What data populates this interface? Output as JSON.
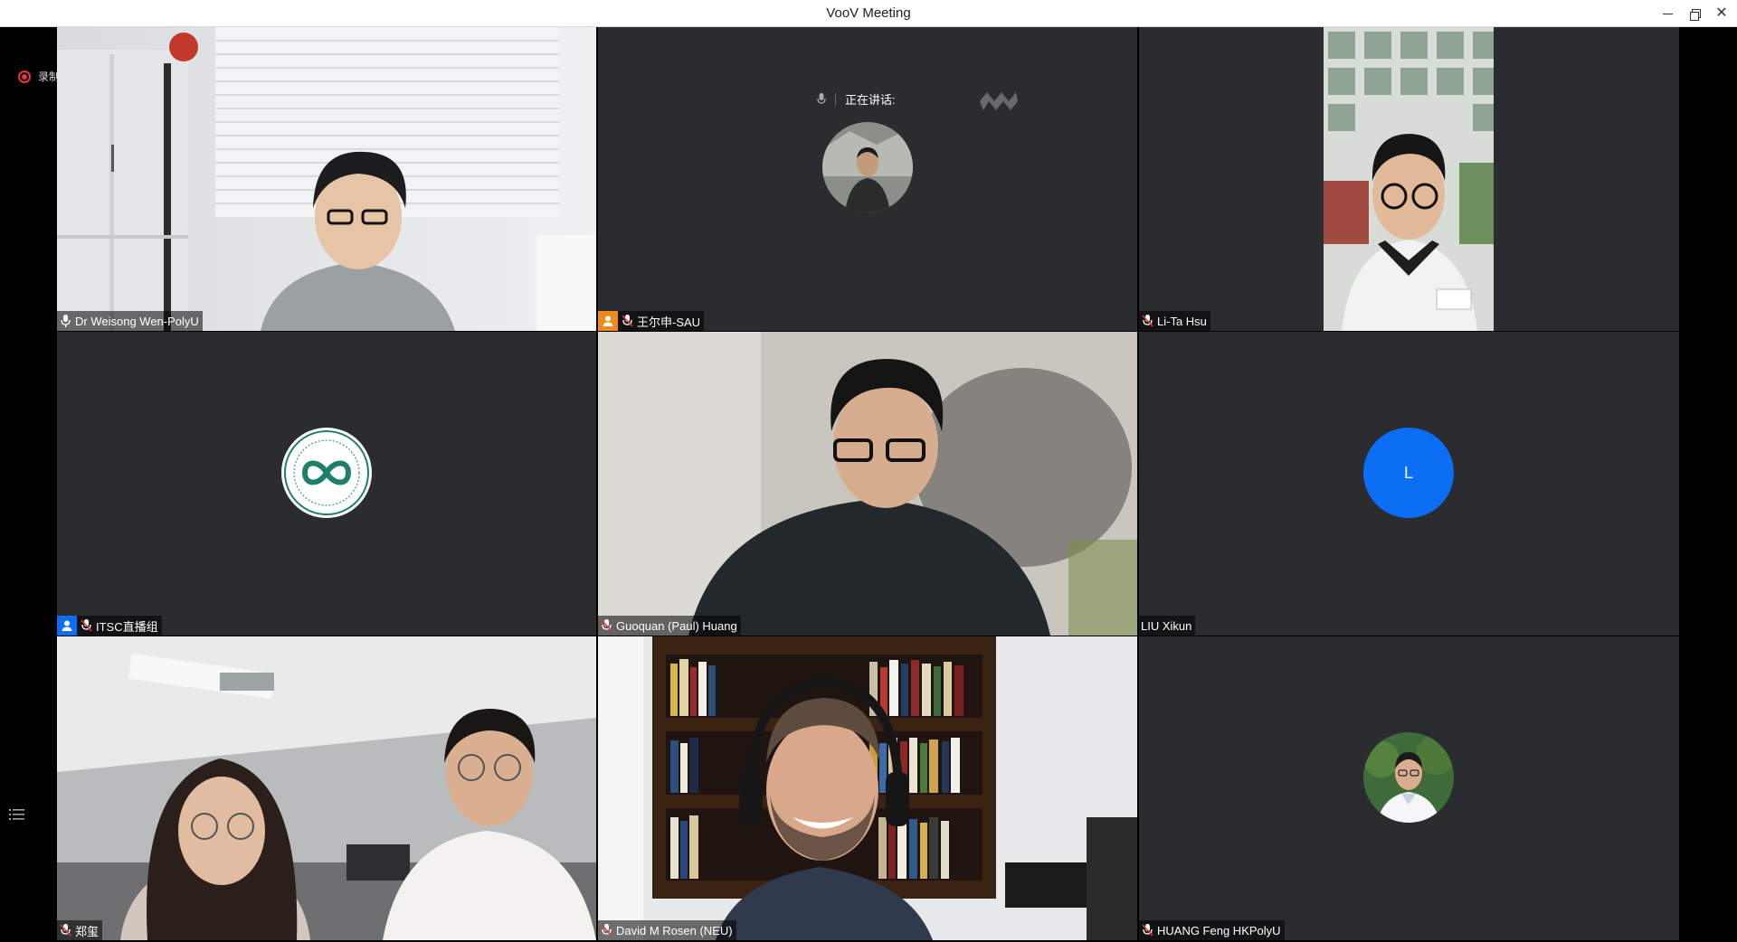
{
  "window": {
    "title": "VooV Meeting"
  },
  "recording": {
    "label": "录制中",
    "color": "#e53935"
  },
  "speaking": {
    "label": "正在讲话:"
  },
  "participants": [
    {
      "name": "Dr Weisong Wen-PolyU",
      "video": true,
      "mic": "on"
    },
    {
      "name": "王尔申-SAU",
      "video": false,
      "mic": "muted",
      "badge": "host-orange"
    },
    {
      "name": "Li-Ta Hsu",
      "video": true,
      "mic": "muted"
    },
    {
      "name": "ITSC直播组",
      "video": false,
      "mic": "muted",
      "badge": "user-blue"
    },
    {
      "name": "Guoquan (Paul) Huang",
      "video": true,
      "mic": "muted"
    },
    {
      "name": "LIU Xikun",
      "video": false,
      "mic": "none",
      "avatar_letter": "L",
      "avatar_color": "#0b6ef5"
    },
    {
      "name": "郑玺",
      "video": true,
      "mic": "muted"
    },
    {
      "name": "David M Rosen (NEU)",
      "video": true,
      "mic": "muted"
    },
    {
      "name": "HUANG Feng HKPolyU",
      "video": false,
      "mic": "muted"
    }
  ],
  "colors": {
    "tile_bg": "#2a2c2f",
    "accent_blue": "#0b6ef5",
    "host_orange": "#f08a1d"
  }
}
